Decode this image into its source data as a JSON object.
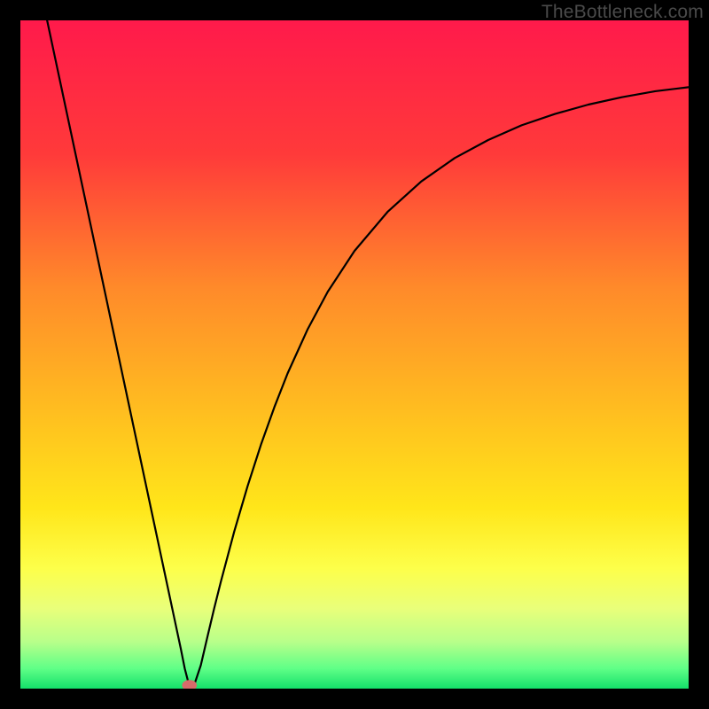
{
  "watermark": "TheBottleneck.com",
  "chart_data": {
    "type": "line",
    "title": "",
    "xlabel": "",
    "ylabel": "",
    "xlim": [
      0,
      100
    ],
    "ylim": [
      0,
      100
    ],
    "gradient_stops": [
      {
        "offset": 0.0,
        "color": "#ff1a4b"
      },
      {
        "offset": 0.2,
        "color": "#ff3a3a"
      },
      {
        "offset": 0.4,
        "color": "#ff8a2a"
      },
      {
        "offset": 0.6,
        "color": "#ffc21f"
      },
      {
        "offset": 0.73,
        "color": "#ffe61a"
      },
      {
        "offset": 0.82,
        "color": "#fdff4a"
      },
      {
        "offset": 0.88,
        "color": "#e9ff7a"
      },
      {
        "offset": 0.93,
        "color": "#b8ff8a"
      },
      {
        "offset": 0.97,
        "color": "#5fff87"
      },
      {
        "offset": 1.0,
        "color": "#14e06a"
      }
    ],
    "series": [
      {
        "name": "curve",
        "points": [
          {
            "x": 4.0,
            "y": 100.0
          },
          {
            "x": 5.0,
            "y": 95.3
          },
          {
            "x": 6.0,
            "y": 90.6
          },
          {
            "x": 7.0,
            "y": 85.9
          },
          {
            "x": 8.0,
            "y": 81.2
          },
          {
            "x": 9.0,
            "y": 76.5
          },
          {
            "x": 10.0,
            "y": 71.8
          },
          {
            "x": 11.0,
            "y": 67.1
          },
          {
            "x": 12.0,
            "y": 62.4
          },
          {
            "x": 13.0,
            "y": 57.7
          },
          {
            "x": 14.0,
            "y": 53.0
          },
          {
            "x": 15.0,
            "y": 48.3
          },
          {
            "x": 16.0,
            "y": 43.6
          },
          {
            "x": 17.0,
            "y": 38.9
          },
          {
            "x": 18.0,
            "y": 34.2
          },
          {
            "x": 19.0,
            "y": 29.5
          },
          {
            "x": 20.0,
            "y": 24.8
          },
          {
            "x": 21.0,
            "y": 20.1
          },
          {
            "x": 22.0,
            "y": 15.4
          },
          {
            "x": 23.0,
            "y": 10.7
          },
          {
            "x": 24.0,
            "y": 6.0
          },
          {
            "x": 24.6,
            "y": 3.0
          },
          {
            "x": 25.3,
            "y": 0.3
          },
          {
            "x": 26.0,
            "y": 0.5
          },
          {
            "x": 27.0,
            "y": 3.5
          },
          {
            "x": 28.0,
            "y": 7.8
          },
          {
            "x": 29.0,
            "y": 12.0
          },
          {
            "x": 30.0,
            "y": 16.0
          },
          {
            "x": 32.0,
            "y": 23.5
          },
          {
            "x": 34.0,
            "y": 30.3
          },
          {
            "x": 36.0,
            "y": 36.5
          },
          {
            "x": 38.0,
            "y": 42.1
          },
          {
            "x": 40.0,
            "y": 47.2
          },
          {
            "x": 43.0,
            "y": 53.8
          },
          {
            "x": 46.0,
            "y": 59.4
          },
          {
            "x": 50.0,
            "y": 65.5
          },
          {
            "x": 55.0,
            "y": 71.4
          },
          {
            "x": 60.0,
            "y": 75.9
          },
          {
            "x": 65.0,
            "y": 79.4
          },
          {
            "x": 70.0,
            "y": 82.1
          },
          {
            "x": 75.0,
            "y": 84.3
          },
          {
            "x": 80.0,
            "y": 86.0
          },
          {
            "x": 85.0,
            "y": 87.4
          },
          {
            "x": 90.0,
            "y": 88.5
          },
          {
            "x": 95.0,
            "y": 89.4
          },
          {
            "x": 100.0,
            "y": 90.0
          }
        ]
      }
    ],
    "marker": {
      "x": 25.3,
      "y": 0.5,
      "rx": 1.1,
      "ry": 0.8,
      "color": "#d66a6a"
    }
  }
}
